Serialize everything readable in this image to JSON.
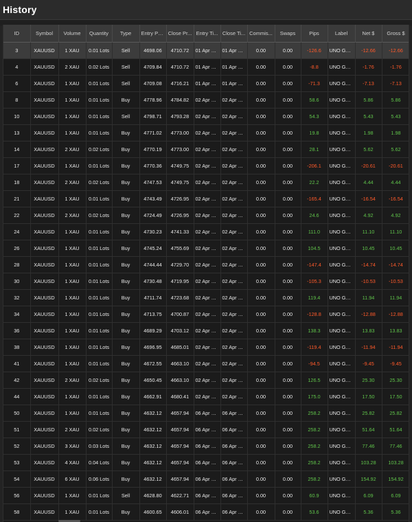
{
  "window": {
    "title": "History"
  },
  "colors": {
    "positive": "#5fc24a",
    "negative": "#ff5a2a",
    "header_bg": "#3a3a3a"
  },
  "columns": [
    "ID",
    "Symbol",
    "Volume",
    "Quantity",
    "Type",
    "Entry Price",
    "Close Pr...",
    "Entry Ti...",
    "Close Ti...",
    "Commis...",
    "Swaps",
    "Pips",
    "Label",
    "Net $",
    "Gross $"
  ],
  "rows": [
    [
      "3",
      "XAUUSD",
      "1 XAU",
      "0.01 Lots",
      "Sell",
      "4698.06",
      "4710.72",
      "01 Apr 20...",
      "01 Apr 20...",
      "0.00",
      "0.00",
      "-126.6",
      "UNO GO...",
      "-12.66",
      "-12.66"
    ],
    [
      "4",
      "XAUUSD",
      "2 XAU",
      "0.02 Lots",
      "Sell",
      "4709.84",
      "4710.72",
      "01 Apr 20...",
      "01 Apr 20...",
      "0.00",
      "0.00",
      "-8.8",
      "UNO GO...",
      "-1.76",
      "-1.76"
    ],
    [
      "6",
      "XAUUSD",
      "1 XAU",
      "0.01 Lots",
      "Sell",
      "4709.08",
      "4716.21",
      "01 Apr 20...",
      "01 Apr 20...",
      "0.00",
      "0.00",
      "-71.3",
      "UNO GO...",
      "-7.13",
      "-7.13"
    ],
    [
      "8",
      "XAUUSD",
      "1 XAU",
      "0.01 Lots",
      "Buy",
      "4778.96",
      "4784.82",
      "02 Apr 20...",
      "02 Apr 20...",
      "0.00",
      "0.00",
      "58.6",
      "UNO GO...",
      "5.86",
      "5.86"
    ],
    [
      "10",
      "XAUUSD",
      "1 XAU",
      "0.01 Lots",
      "Sell",
      "4798.71",
      "4793.28",
      "02 Apr 20...",
      "02 Apr 20...",
      "0.00",
      "0.00",
      "54.3",
      "UNO GO...",
      "5.43",
      "5.43"
    ],
    [
      "13",
      "XAUUSD",
      "1 XAU",
      "0.01 Lots",
      "Buy",
      "4771.02",
      "4773.00",
      "02 Apr 20...",
      "02 Apr 20...",
      "0.00",
      "0.00",
      "19.8",
      "UNO GO...",
      "1.98",
      "1.98"
    ],
    [
      "14",
      "XAUUSD",
      "2 XAU",
      "0.02 Lots",
      "Buy",
      "4770.19",
      "4773.00",
      "02 Apr 20...",
      "02 Apr 20...",
      "0.00",
      "0.00",
      "28.1",
      "UNO GO...",
      "5.62",
      "5.62"
    ],
    [
      "17",
      "XAUUSD",
      "1 XAU",
      "0.01 Lots",
      "Buy",
      "4770.36",
      "4749.75",
      "02 Apr 20...",
      "02 Apr 20...",
      "0.00",
      "0.00",
      "-206.1",
      "UNO GO...",
      "-20.61",
      "-20.61"
    ],
    [
      "18",
      "XAUUSD",
      "2 XAU",
      "0.02 Lots",
      "Buy",
      "4747.53",
      "4749.75",
      "02 Apr 20...",
      "02 Apr 20...",
      "0.00",
      "0.00",
      "22.2",
      "UNO GO...",
      "4.44",
      "4.44"
    ],
    [
      "21",
      "XAUUSD",
      "1 XAU",
      "0.01 Lots",
      "Buy",
      "4743.49",
      "4726.95",
      "02 Apr 20...",
      "02 Apr 20...",
      "0.00",
      "0.00",
      "-165.4",
      "UNO GO...",
      "-16.54",
      "-16.54"
    ],
    [
      "22",
      "XAUUSD",
      "2 XAU",
      "0.02 Lots",
      "Buy",
      "4724.49",
      "4726.95",
      "02 Apr 20...",
      "02 Apr 20...",
      "0.00",
      "0.00",
      "24.6",
      "UNO GO...",
      "4.92",
      "4.92"
    ],
    [
      "24",
      "XAUUSD",
      "1 XAU",
      "0.01 Lots",
      "Buy",
      "4730.23",
      "4741.33",
      "02 Apr 20...",
      "02 Apr 20...",
      "0.00",
      "0.00",
      "111.0",
      "UNO GO...",
      "11.10",
      "11.10"
    ],
    [
      "26",
      "XAUUSD",
      "1 XAU",
      "0.01 Lots",
      "Buy",
      "4745.24",
      "4755.69",
      "02 Apr 20...",
      "02 Apr 20...",
      "0.00",
      "0.00",
      "104.5",
      "UNO GO...",
      "10.45",
      "10.45"
    ],
    [
      "28",
      "XAUUSD",
      "1 XAU",
      "0.01 Lots",
      "Buy",
      "4744.44",
      "4729.70",
      "02 Apr 20...",
      "02 Apr 20...",
      "0.00",
      "0.00",
      "-147.4",
      "UNO GO...",
      "-14.74",
      "-14.74"
    ],
    [
      "30",
      "XAUUSD",
      "1 XAU",
      "0.01 Lots",
      "Buy",
      "4730.48",
      "4719.95",
      "02 Apr 20...",
      "02 Apr 20...",
      "0.00",
      "0.00",
      "-105.3",
      "UNO GO...",
      "-10.53",
      "-10.53"
    ],
    [
      "32",
      "XAUUSD",
      "1 XAU",
      "0.01 Lots",
      "Buy",
      "4711.74",
      "4723.68",
      "02 Apr 20...",
      "02 Apr 20...",
      "0.00",
      "0.00",
      "119.4",
      "UNO GO...",
      "11.94",
      "11.94"
    ],
    [
      "34",
      "XAUUSD",
      "1 XAU",
      "0.01 Lots",
      "Buy",
      "4713.75",
      "4700.87",
      "02 Apr 20...",
      "02 Apr 20...",
      "0.00",
      "0.00",
      "-128.8",
      "UNO GO...",
      "-12.88",
      "-12.88"
    ],
    [
      "36",
      "XAUUSD",
      "1 XAU",
      "0.01 Lots",
      "Buy",
      "4689.29",
      "4703.12",
      "02 Apr 20...",
      "02 Apr 20...",
      "0.00",
      "0.00",
      "138.3",
      "UNO GO...",
      "13.83",
      "13.83"
    ],
    [
      "38",
      "XAUUSD",
      "1 XAU",
      "0.01 Lots",
      "Buy",
      "4696.95",
      "4685.01",
      "02 Apr 20...",
      "02 Apr 20...",
      "0.00",
      "0.00",
      "-119.4",
      "UNO GO...",
      "-11.94",
      "-11.94"
    ],
    [
      "41",
      "XAUUSD",
      "1 XAU",
      "0.01 Lots",
      "Buy",
      "4672.55",
      "4663.10",
      "02 Apr 20...",
      "02 Apr 20...",
      "0.00",
      "0.00",
      "-94.5",
      "UNO GO...",
      "-9.45",
      "-9.45"
    ],
    [
      "42",
      "XAUUSD",
      "2 XAU",
      "0.02 Lots",
      "Buy",
      "4650.45",
      "4663.10",
      "02 Apr 20...",
      "02 Apr 20...",
      "0.00",
      "0.00",
      "126.5",
      "UNO GO...",
      "25.30",
      "25.30"
    ],
    [
      "44",
      "XAUUSD",
      "1 XAU",
      "0.01 Lots",
      "Buy",
      "4662.91",
      "4680.41",
      "02 Apr 20...",
      "02 Apr 20...",
      "0.00",
      "0.00",
      "175.0",
      "UNO GO...",
      "17.50",
      "17.50"
    ],
    [
      "50",
      "XAUUSD",
      "1 XAU",
      "0.01 Lots",
      "Buy",
      "4632.12",
      "4657.94",
      "06 Apr 20...",
      "06 Apr 20...",
      "0.00",
      "0.00",
      "258.2",
      "UNO GO...",
      "25.82",
      "25.82"
    ],
    [
      "51",
      "XAUUSD",
      "2 XAU",
      "0.02 Lots",
      "Buy",
      "4632.12",
      "4657.94",
      "06 Apr 20...",
      "06 Apr 20...",
      "0.00",
      "0.00",
      "258.2",
      "UNO GO...",
      "51.64",
      "51.64"
    ],
    [
      "52",
      "XAUUSD",
      "3 XAU",
      "0.03 Lots",
      "Buy",
      "4632.12",
      "4657.94",
      "06 Apr 20...",
      "06 Apr 20...",
      "0.00",
      "0.00",
      "258.2",
      "UNO GO...",
      "77.46",
      "77.46"
    ],
    [
      "53",
      "XAUUSD",
      "4 XAU",
      "0.04 Lots",
      "Buy",
      "4632.12",
      "4657.94",
      "06 Apr 20...",
      "06 Apr 20...",
      "0.00",
      "0.00",
      "258.2",
      "UNO GO...",
      "103.28",
      "103.28"
    ],
    [
      "54",
      "XAUUSD",
      "6 XAU",
      "0.06 Lots",
      "Buy",
      "4632.12",
      "4657.94",
      "06 Apr 20...",
      "06 Apr 20...",
      "0.00",
      "0.00",
      "258.2",
      "UNO GO...",
      "154.92",
      "154.92"
    ],
    [
      "56",
      "XAUUSD",
      "1 XAU",
      "0.01 Lots",
      "Sell",
      "4628.80",
      "4622.71",
      "06 Apr 20...",
      "06 Apr 20...",
      "0.00",
      "0.00",
      "60.9",
      "UNO GO...",
      "6.09",
      "6.09"
    ],
    [
      "58",
      "XAUUSD",
      "1 XAU",
      "0.01 Lots",
      "Buy",
      "4600.65",
      "4606.01",
      "06 Apr 20...",
      "06 Apr 20...",
      "0.00",
      "0.00",
      "53.6",
      "UNO GO...",
      "5.36",
      "5.36"
    ]
  ]
}
